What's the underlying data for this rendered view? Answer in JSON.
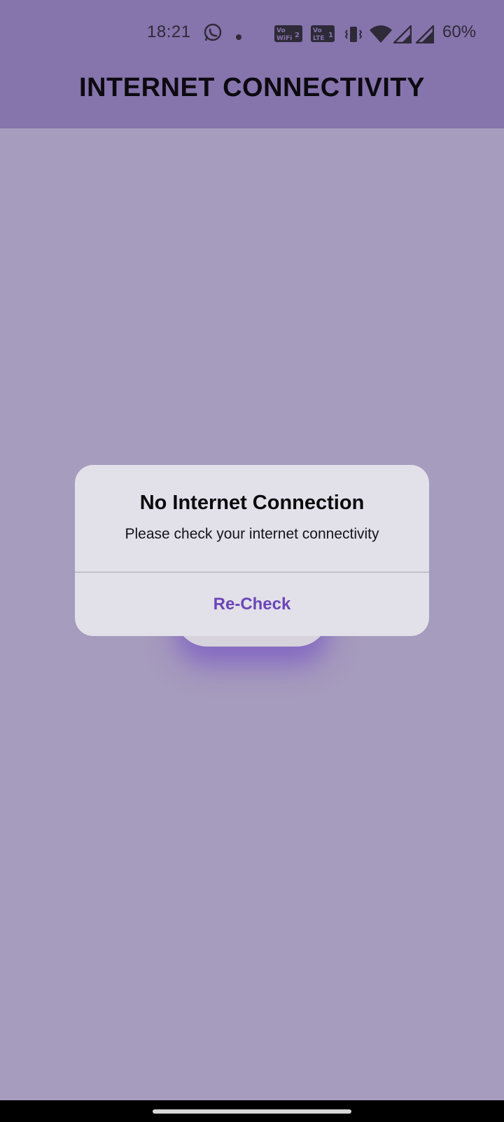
{
  "status_bar": {
    "time": "18:21",
    "battery": "60%",
    "icons": [
      "whatsapp-icon",
      "dot-icon",
      "vowifi-icon",
      "volte-icon",
      "vibrate-icon",
      "wifi-icon",
      "signal-icon",
      "signal-icon",
      "battery-text"
    ],
    "vowifi_label": "Vo WiFi 2",
    "volte_label": "Vo LTE 1"
  },
  "app_bar": {
    "title": "INTERNET CONNECTIVITY"
  },
  "dialog": {
    "title": "No Internet Connection",
    "message": "Please check your internet connectivity",
    "action_label": "Re-Check"
  },
  "colors": {
    "app_bar": "#8674ac",
    "background": "#a69cbd",
    "dialog": "#e2e0e8",
    "accent": "#6a46b8"
  }
}
